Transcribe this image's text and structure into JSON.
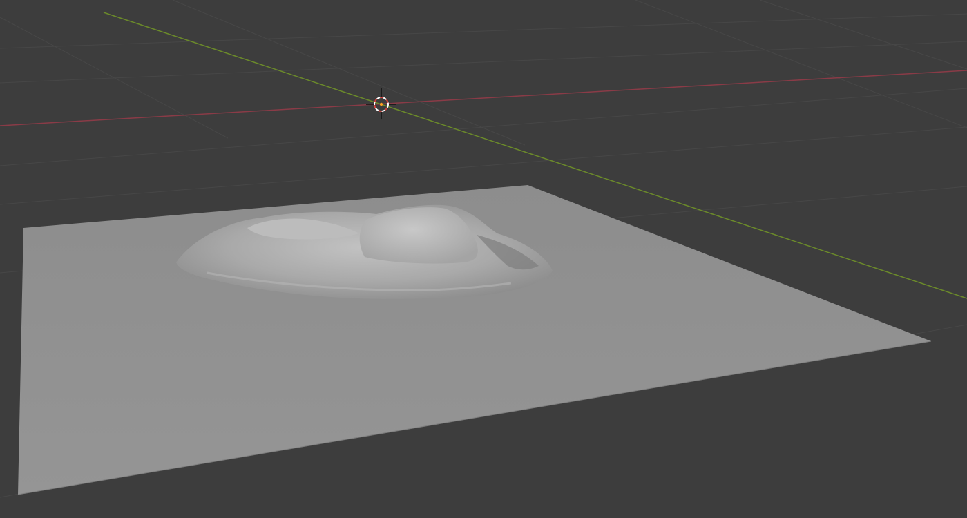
{
  "viewport": {
    "mode": "3d-viewport",
    "shading": "solid",
    "colors": {
      "background": "#3d3d3d",
      "grid_line": "#474747",
      "x_axis": "#8a3b47",
      "y_axis": "#6b8a2a",
      "terrain_plane": "#8e8e8e",
      "terrain_highlight": "#bdbdbd",
      "cursor_ring_a": "#ffffff",
      "cursor_ring_b": "#d0403a",
      "origin_dot": "#ffa020"
    }
  },
  "objects": [
    {
      "name": "terrain-mesh",
      "type": "mesh",
      "selected": false
    },
    {
      "name": "3d-cursor",
      "type": "cursor"
    }
  ]
}
